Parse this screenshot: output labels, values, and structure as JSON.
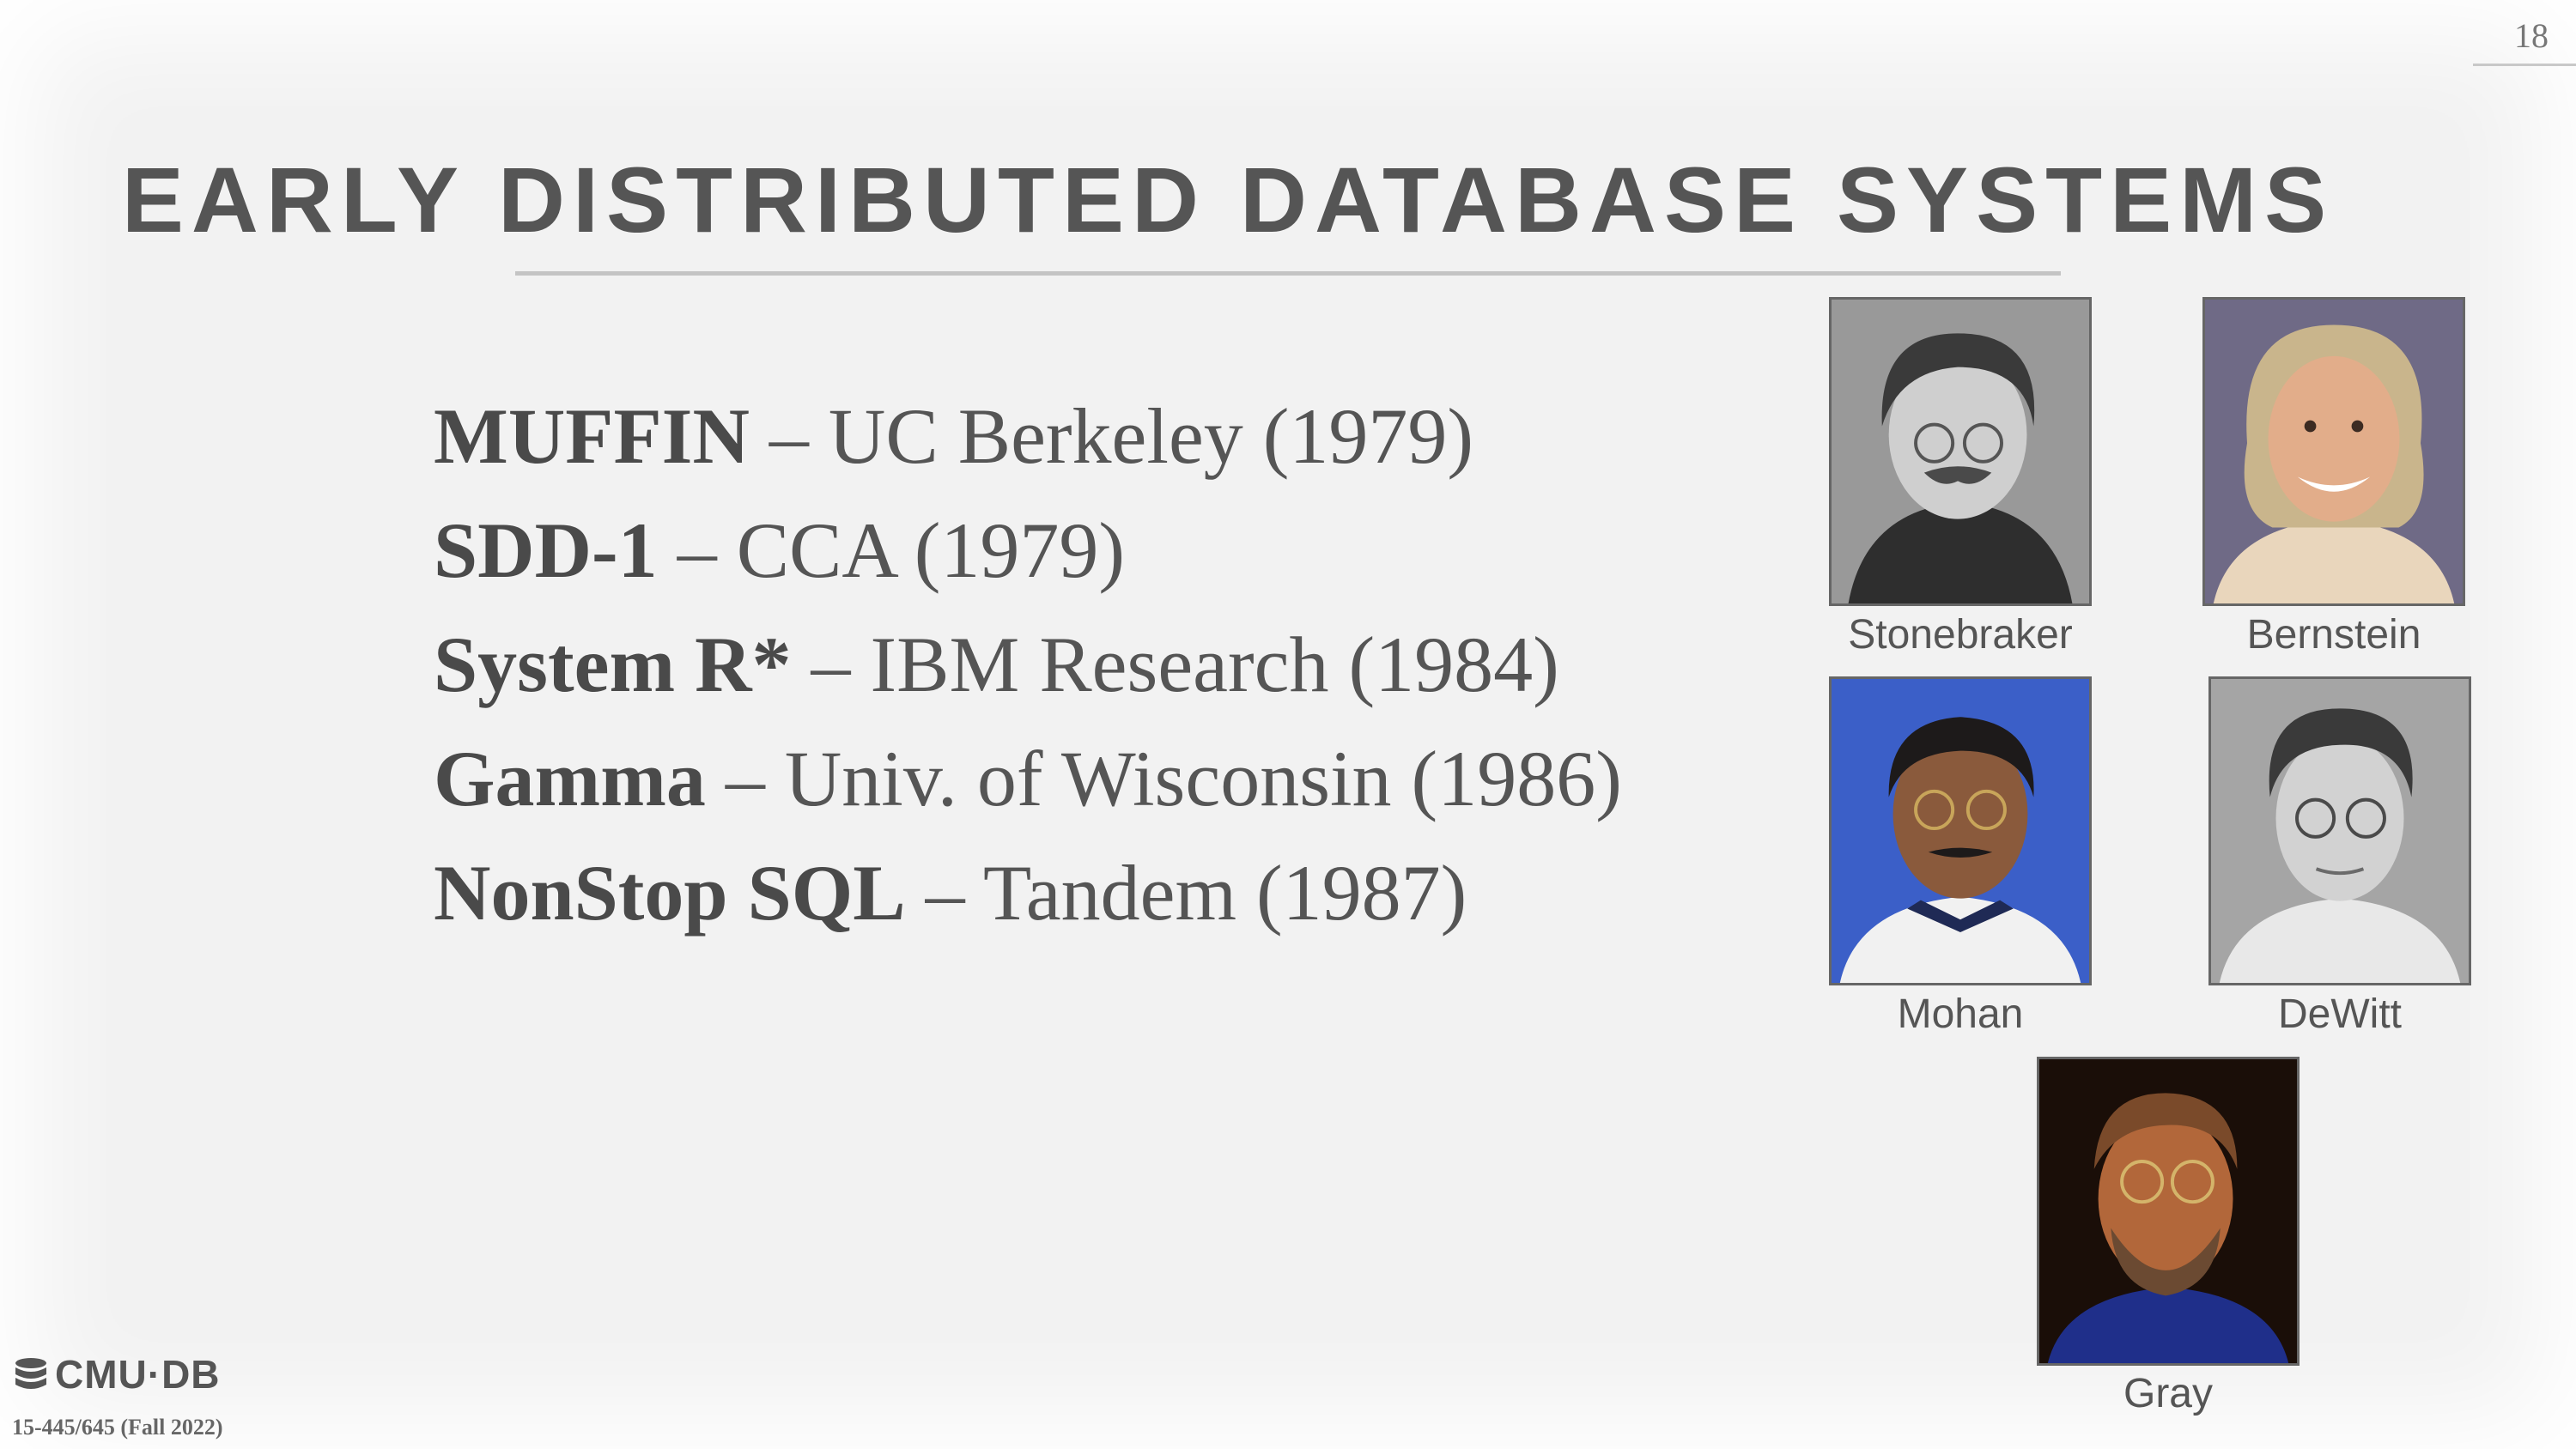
{
  "slide": {
    "page_number": "18",
    "title": "EARLY DISTRIBUTED DATABASE SYSTEMS",
    "bullets": [
      {
        "name": "MUFFIN",
        "detail": " – UC Berkeley (1979)"
      },
      {
        "name": "SDD-1",
        "detail": " – CCA (1979)"
      },
      {
        "name": "System R*",
        "detail": " – IBM Research (1984)"
      },
      {
        "name": "Gamma",
        "detail": " – Univ. of Wisconsin (1986)"
      },
      {
        "name": "NonStop SQL",
        "detail": " – Tandem (1987)"
      }
    ],
    "portraits": [
      {
        "caption": "Stonebraker",
        "icon": "portrait-photo"
      },
      {
        "caption": "Bernstein",
        "icon": "portrait-photo"
      },
      {
        "caption": "Mohan",
        "icon": "portrait-photo"
      },
      {
        "caption": "DeWitt",
        "icon": "portrait-photo"
      },
      {
        "caption": "Gray",
        "icon": "portrait-photo"
      }
    ],
    "footer": {
      "logo_text": "CMU·DB",
      "course": "15-445/645 (Fall 2022)"
    },
    "colors": {
      "background": "#f2f2f2",
      "text": "#555555"
    }
  }
}
